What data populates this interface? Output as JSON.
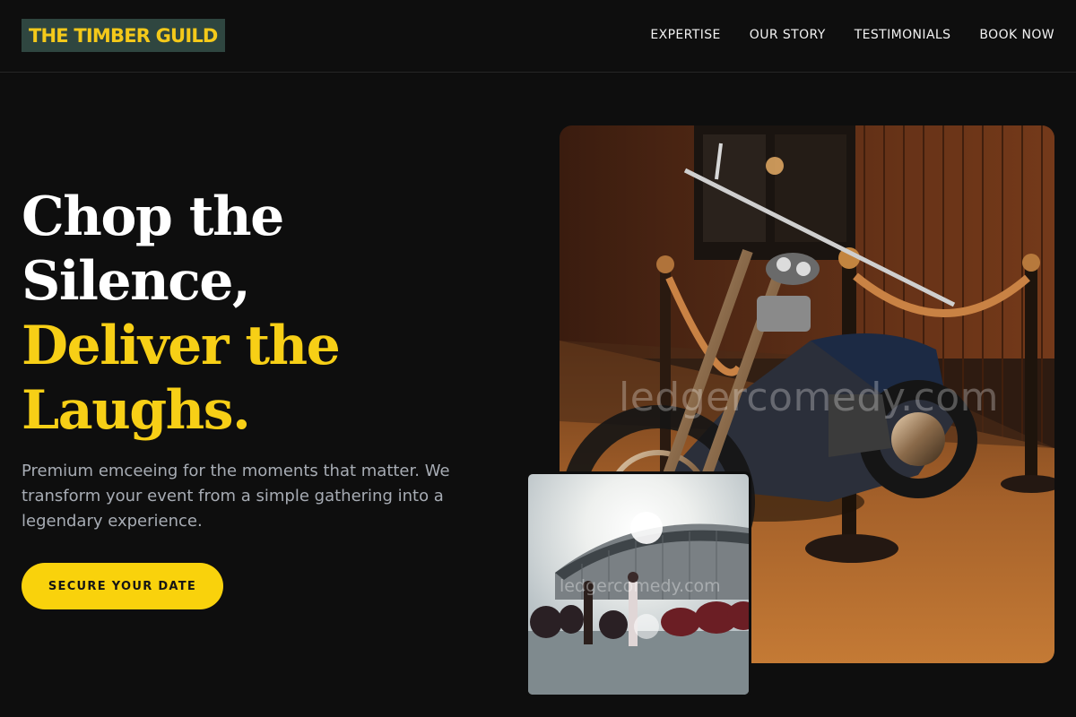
{
  "header": {
    "logo": "THE TIMBER GUILD",
    "nav": [
      "EXPERTISE",
      "OUR STORY",
      "TESTIMONIALS",
      "BOOK NOW"
    ]
  },
  "hero": {
    "headline_white": [
      "Chop the",
      "Silence,"
    ],
    "headline_gold": [
      "Deliver the",
      "Laughs."
    ],
    "tagline": "Premium emceeing for the moments that matter. We transform your event from a simple gathering into a legendary experience.",
    "cta": "SECURE YOUR DATE"
  },
  "images": {
    "main_watermark": "ledgercomedy.com",
    "small_watermark": "ledgercomedy.com"
  },
  "colors": {
    "background": "#0e0e0e",
    "accent": "#f7cf16",
    "logo_bg": "#2f4640"
  }
}
